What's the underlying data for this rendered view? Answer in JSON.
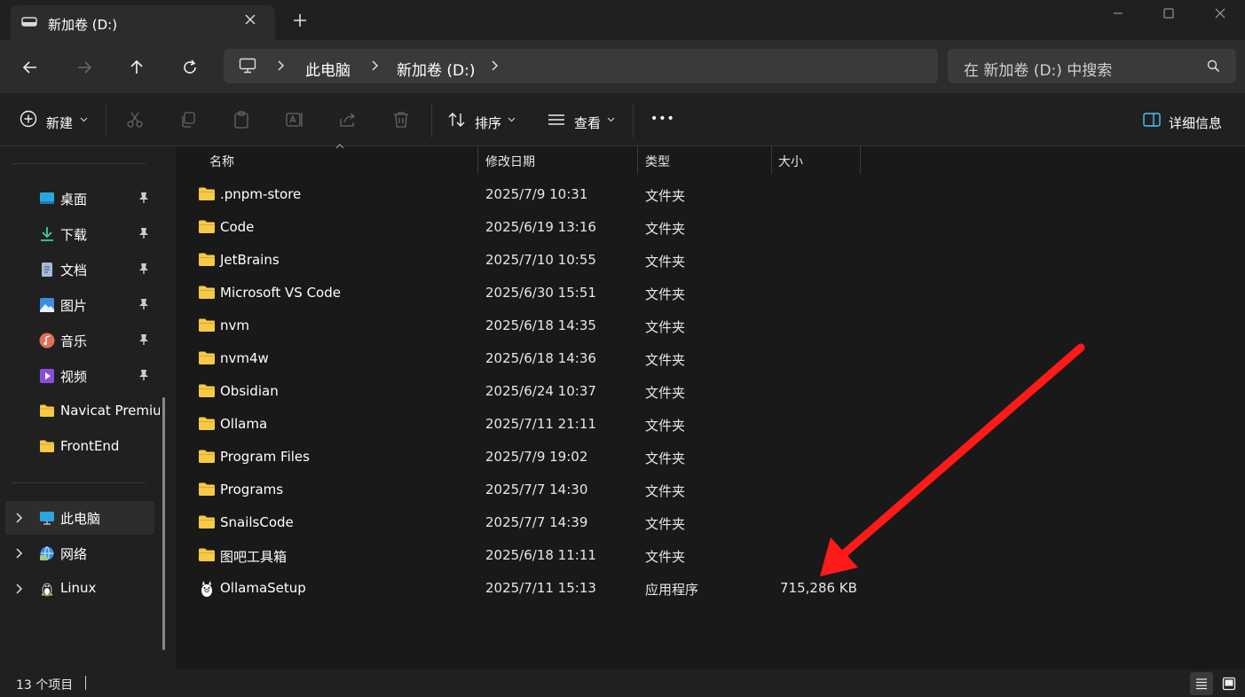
{
  "window": {
    "tab_title": "新加卷 (D:)"
  },
  "navigation": {
    "breadcrumbs": [
      "此电脑",
      "新加卷 (D:)"
    ],
    "search_placeholder": "在 新加卷 (D:) 中搜索"
  },
  "toolbar": {
    "new_label": "新建",
    "sort_label": "排序",
    "view_label": "查看",
    "more_label": "•••",
    "details_label": "详细信息"
  },
  "sidebar": {
    "quick_access": [
      {
        "label": "桌面",
        "pinned": true,
        "icon": "desktop-icon"
      },
      {
        "label": "下载",
        "pinned": true,
        "icon": "download-icon"
      },
      {
        "label": "文档",
        "pinned": true,
        "icon": "document-icon"
      },
      {
        "label": "图片",
        "pinned": true,
        "icon": "picture-icon"
      },
      {
        "label": "音乐",
        "pinned": true,
        "icon": "music-icon"
      },
      {
        "label": "视频",
        "pinned": true,
        "icon": "video-icon"
      },
      {
        "label": "Navicat Premium",
        "pinned": false,
        "icon": "folder-icon"
      },
      {
        "label": "FrontEnd",
        "pinned": false,
        "icon": "folder-icon"
      }
    ],
    "locations": [
      {
        "label": "此电脑",
        "icon": "computer-icon",
        "selected": true
      },
      {
        "label": "网络",
        "icon": "network-icon",
        "selected": false
      },
      {
        "label": "Linux",
        "icon": "linux-icon",
        "selected": false
      }
    ]
  },
  "file_list": {
    "columns": [
      "名称",
      "修改日期",
      "类型",
      "大小"
    ],
    "rows": [
      {
        "name": ".pnpm-store",
        "date": "2025/7/9 10:31",
        "type": "文件夹",
        "size": ""
      },
      {
        "name": "Code",
        "date": "2025/6/19 13:16",
        "type": "文件夹",
        "size": ""
      },
      {
        "name": "JetBrains",
        "date": "2025/7/10 10:55",
        "type": "文件夹",
        "size": ""
      },
      {
        "name": "Microsoft VS Code",
        "date": "2025/6/30 15:51",
        "type": "文件夹",
        "size": ""
      },
      {
        "name": "nvm",
        "date": "2025/6/18 14:35",
        "type": "文件夹",
        "size": ""
      },
      {
        "name": "nvm4w",
        "date": "2025/6/18 14:36",
        "type": "文件夹",
        "size": ""
      },
      {
        "name": "Obsidian",
        "date": "2025/6/24 10:37",
        "type": "文件夹",
        "size": ""
      },
      {
        "name": "Ollama",
        "date": "2025/7/11 21:11",
        "type": "文件夹",
        "size": ""
      },
      {
        "name": "Program Files",
        "date": "2025/7/9 19:02",
        "type": "文件夹",
        "size": ""
      },
      {
        "name": "Programs",
        "date": "2025/7/7 14:30",
        "type": "文件夹",
        "size": ""
      },
      {
        "name": "SnailsCode",
        "date": "2025/7/7 14:39",
        "type": "文件夹",
        "size": ""
      },
      {
        "name": "图吧工具箱",
        "date": "2025/6/18 11:11",
        "type": "文件夹",
        "size": ""
      },
      {
        "name": "OllamaSetup",
        "date": "2025/7/11 15:13",
        "type": "应用程序",
        "size": "715,286 KB"
      }
    ]
  },
  "status": {
    "item_count": "13 个项目"
  },
  "colors": {
    "folder": "#f7c948",
    "annotation_arrow": "#ff1a1a",
    "background": "#191919"
  }
}
